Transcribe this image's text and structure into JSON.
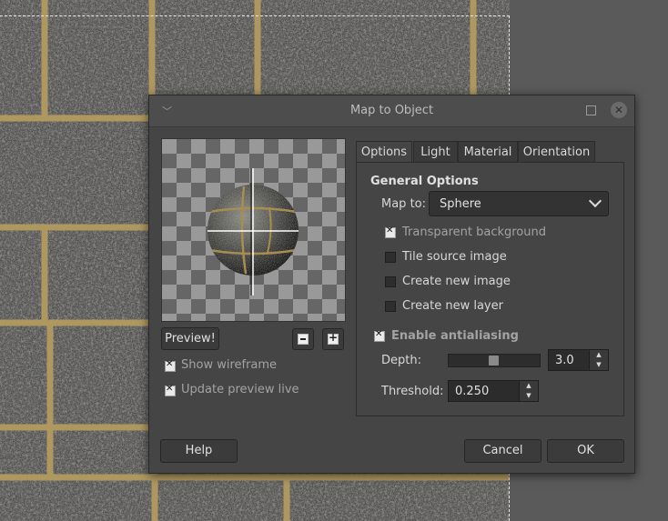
{
  "dialog": {
    "title": "Map to Object",
    "preview_button": "Preview!",
    "show_wireframe": {
      "label": "Show wireframe",
      "checked": true
    },
    "update_preview_live": {
      "label": "Update preview live",
      "checked": true
    },
    "tabs": [
      "Options",
      "Light",
      "Material",
      "Orientation"
    ],
    "active_tab": "Options",
    "general_options_title": "General Options",
    "map_to": {
      "label": "Map to:",
      "value": "Sphere"
    },
    "transparent_background": {
      "label": "Transparent background",
      "checked": true
    },
    "tile_source_image": {
      "label": "Tile source image",
      "checked": false
    },
    "create_new_image": {
      "label": "Create new image",
      "checked": false
    },
    "create_new_layer": {
      "label": "Create new layer",
      "checked": false
    },
    "enable_antialiasing": {
      "label": "Enable antialiasing",
      "checked": true
    },
    "depth": {
      "label": "Depth:",
      "value": "3.0",
      "slider_fraction": 0.5
    },
    "threshold": {
      "label": "Threshold:",
      "value": "0.250"
    },
    "help_button": "Help",
    "cancel_button": "Cancel",
    "ok_button": "OK"
  },
  "icons": {
    "menu": "chevron-down-icon",
    "maximize": "maximize-icon",
    "close": "close-icon",
    "zoom_out": "zoom-out-icon",
    "zoom_in": "zoom-in-icon"
  },
  "colors": {
    "dialog_bg": "#454545",
    "workspace_bg": "#5a5a5a",
    "grout": "#b39b5f"
  }
}
